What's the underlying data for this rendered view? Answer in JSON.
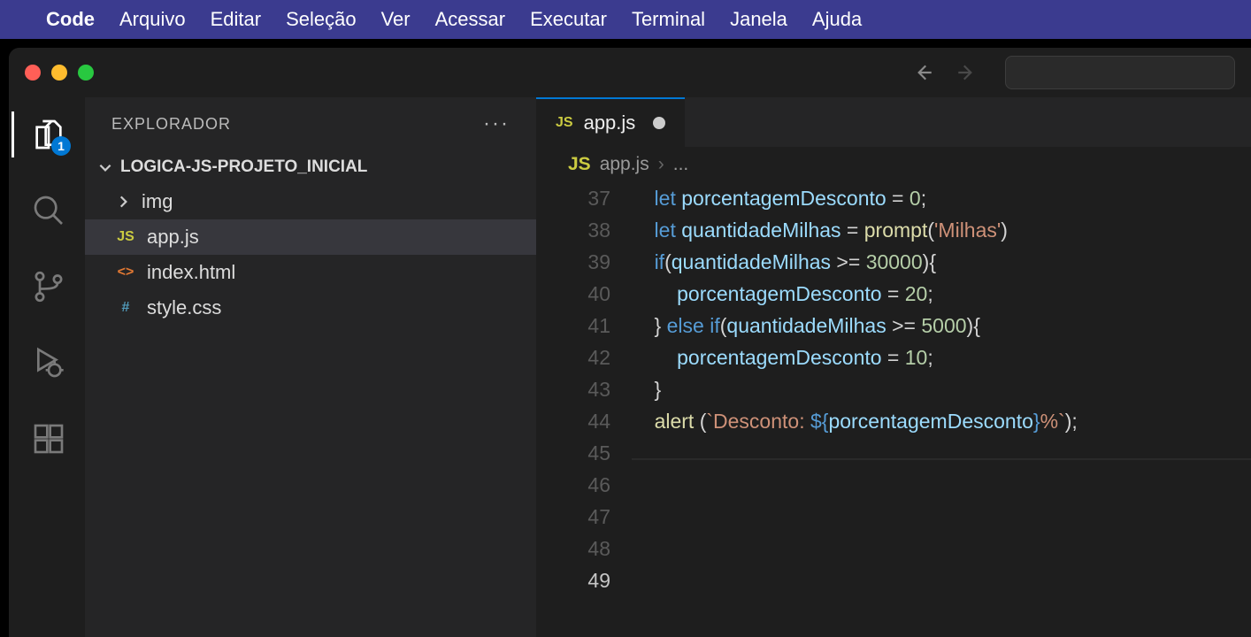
{
  "menubar": {
    "app": "Code",
    "items": [
      "Arquivo",
      "Editar",
      "Seleção",
      "Ver",
      "Acessar",
      "Executar",
      "Terminal",
      "Janela",
      "Ajuda"
    ]
  },
  "activitybar": {
    "explorer_badge": "1"
  },
  "sidebar": {
    "title": "EXPLORADOR",
    "project": "LOGICA-JS-PROJETO_INICIAL",
    "tree": [
      {
        "kind": "folder",
        "name": "img"
      },
      {
        "kind": "js",
        "name": "app.js",
        "selected": true
      },
      {
        "kind": "html",
        "name": "index.html"
      },
      {
        "kind": "css",
        "name": "style.css"
      }
    ]
  },
  "editor": {
    "tab": {
      "icon": "JS",
      "name": "app.js",
      "dirty": true
    },
    "breadcrumb": {
      "icon": "JS",
      "file": "app.js",
      "rest": "..."
    },
    "first_line": 37,
    "current_line": 49,
    "lines": [
      {
        "n": 37,
        "seg": [
          {
            "c": "kw",
            "t": "    let "
          },
          {
            "c": "var",
            "t": "porcentagemDesconto"
          },
          {
            "c": "op",
            "t": " = "
          },
          {
            "c": "num",
            "t": "0"
          },
          {
            "c": "op",
            "t": ";"
          }
        ]
      },
      {
        "n": 38,
        "seg": [
          {
            "c": "kw",
            "t": "    let "
          },
          {
            "c": "var",
            "t": "quantidadeMilhas"
          },
          {
            "c": "op",
            "t": " = "
          },
          {
            "c": "fn",
            "t": "prompt"
          },
          {
            "c": "op",
            "t": "("
          },
          {
            "c": "str",
            "t": "'Milhas'"
          },
          {
            "c": "op",
            "t": ")"
          }
        ]
      },
      {
        "n": 39,
        "seg": [
          {
            "c": "op",
            "t": ""
          }
        ]
      },
      {
        "n": 40,
        "seg": [
          {
            "c": "op",
            "t": "    "
          },
          {
            "c": "kw",
            "t": "if"
          },
          {
            "c": "op",
            "t": "("
          },
          {
            "c": "var",
            "t": "quantidadeMilhas"
          },
          {
            "c": "op",
            "t": " >= "
          },
          {
            "c": "num",
            "t": "30000"
          },
          {
            "c": "op",
            "t": "){"
          }
        ]
      },
      {
        "n": 41,
        "seg": [
          {
            "c": "op",
            "t": "        "
          },
          {
            "c": "var",
            "t": "porcentagemDesconto"
          },
          {
            "c": "op",
            "t": " = "
          },
          {
            "c": "num",
            "t": "20"
          },
          {
            "c": "op",
            "t": ";"
          }
        ]
      },
      {
        "n": 42,
        "seg": [
          {
            "c": "op",
            "t": ""
          }
        ]
      },
      {
        "n": 43,
        "seg": [
          {
            "c": "op",
            "t": "    } "
          },
          {
            "c": "kw",
            "t": "else if"
          },
          {
            "c": "op",
            "t": "("
          },
          {
            "c": "var",
            "t": "quantidadeMilhas"
          },
          {
            "c": "op",
            "t": " >= "
          },
          {
            "c": "num",
            "t": "5000"
          },
          {
            "c": "op",
            "t": "){"
          }
        ]
      },
      {
        "n": 44,
        "seg": [
          {
            "c": "op",
            "t": "        "
          },
          {
            "c": "var",
            "t": "porcentagemDesconto"
          },
          {
            "c": "op",
            "t": " = "
          },
          {
            "c": "num",
            "t": "10"
          },
          {
            "c": "op",
            "t": ";"
          }
        ]
      },
      {
        "n": 45,
        "seg": [
          {
            "c": "op",
            "t": "    }"
          }
        ]
      },
      {
        "n": 46,
        "seg": [
          {
            "c": "op",
            "t": "    "
          },
          {
            "c": "fn",
            "t": "alert "
          },
          {
            "c": "op",
            "t": "("
          },
          {
            "c": "str",
            "t": "`Desconto: "
          },
          {
            "c": "tmpl",
            "t": "${"
          },
          {
            "c": "var",
            "t": "porcentagemDesconto"
          },
          {
            "c": "tmpl",
            "t": "}"
          },
          {
            "c": "str",
            "t": "%`"
          },
          {
            "c": "op",
            "t": ");"
          }
        ]
      },
      {
        "n": 47,
        "seg": [
          {
            "c": "op",
            "t": ""
          }
        ]
      },
      {
        "n": 48,
        "seg": [
          {
            "c": "op",
            "t": ""
          }
        ]
      },
      {
        "n": 49,
        "seg": [
          {
            "c": "op",
            "t": ""
          }
        ],
        "current": true
      }
    ]
  }
}
